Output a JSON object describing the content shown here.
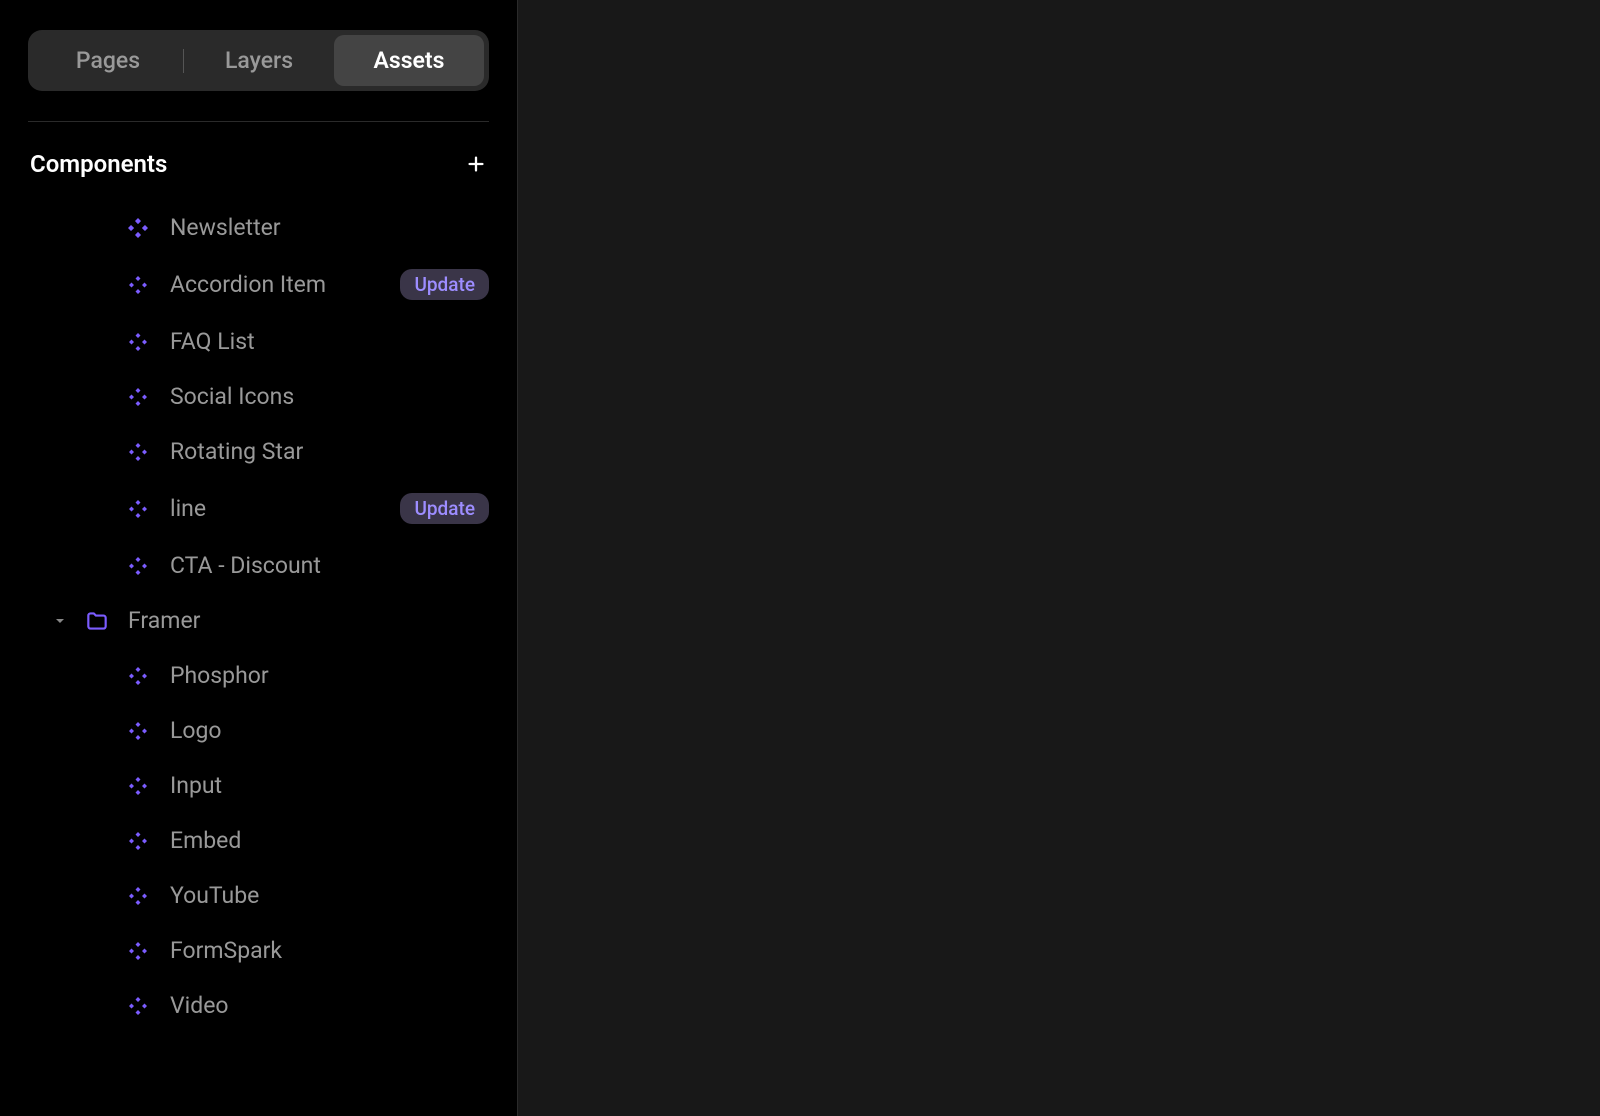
{
  "tabs": {
    "pages": "Pages",
    "layers": "Layers",
    "assets": "Assets"
  },
  "section": {
    "title": "Components"
  },
  "components": [
    {
      "label": "Newsletter",
      "badge": null
    },
    {
      "label": "Accordion Item",
      "badge": "Update"
    },
    {
      "label": "FAQ List",
      "badge": null
    },
    {
      "label": "Social Icons",
      "badge": null
    },
    {
      "label": "Rotating Star",
      "badge": null
    },
    {
      "label": "line",
      "badge": "Update"
    },
    {
      "label": "CTA - Discount",
      "badge": null
    }
  ],
  "folder": {
    "name": "Framer",
    "children": [
      {
        "label": "Phosphor"
      },
      {
        "label": "Logo"
      },
      {
        "label": "Input"
      },
      {
        "label": "Embed"
      },
      {
        "label": "YouTube"
      },
      {
        "label": "FormSpark"
      },
      {
        "label": "Video"
      }
    ]
  }
}
